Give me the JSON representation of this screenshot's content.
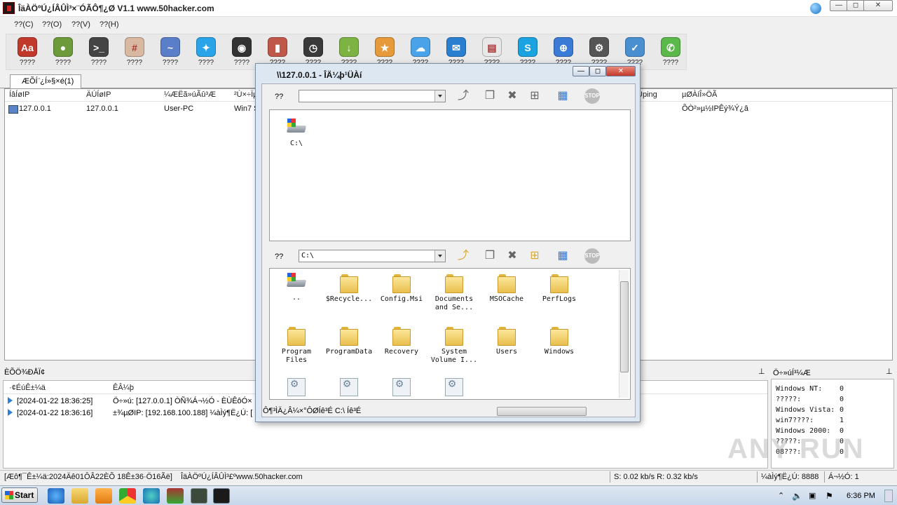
{
  "window": {
    "title": "ÎäÀÖºÚ¿ÍÂÛÌ³×¨ÓÃÔ¶¿Ø V1.1 www.50hacker.com",
    "min": "—",
    "max": "◻",
    "close": "✕"
  },
  "menu": [
    "??(C)",
    "??(O)",
    "??(V)",
    "??(H)"
  ],
  "toolbar": [
    {
      "label": "????",
      "icon": "dictionary-icon",
      "color": "#c0392b",
      "glyph": "Aa"
    },
    {
      "label": "????",
      "icon": "disk-icon",
      "color": "#6d9a3a",
      "glyph": "●"
    },
    {
      "label": "????",
      "icon": "terminal-icon",
      "color": "#444444",
      "glyph": ">_"
    },
    {
      "label": "????",
      "icon": "calculator-icon",
      "color": "#d8b8a0",
      "glyph": "#"
    },
    {
      "label": "????",
      "icon": "activity-monitor-icon",
      "color": "#5a7ec8",
      "glyph": "~"
    },
    {
      "label": "????",
      "icon": "app-store-icon",
      "color": "#2aa4e8",
      "glyph": "✦"
    },
    {
      "label": "????",
      "icon": "camera-icon",
      "color": "#333333",
      "glyph": "◉"
    },
    {
      "label": "????",
      "icon": "microphone-icon",
      "color": "#c0584a",
      "glyph": "▮"
    },
    {
      "label": "????",
      "icon": "clock-icon",
      "color": "#3a3a3a",
      "glyph": "◷"
    },
    {
      "label": "????",
      "icon": "download-icon",
      "color": "#7cb342",
      "glyph": "↓"
    },
    {
      "label": "????",
      "icon": "star-icon",
      "color": "#e69a3a",
      "glyph": "★"
    },
    {
      "label": "????",
      "icon": "cloud-icon",
      "color": "#4aa3e8",
      "glyph": "☁"
    },
    {
      "label": "????",
      "icon": "chat-icon",
      "color": "#2a7fd0",
      "glyph": "✉"
    },
    {
      "label": "????",
      "icon": "calendar-icon",
      "color": "#e8e8e8",
      "glyph": "▤"
    },
    {
      "label": "????",
      "icon": "skype-icon",
      "color": "#1aa3e0",
      "glyph": "S"
    },
    {
      "label": "????",
      "icon": "globe-icon",
      "color": "#3a7bd5",
      "glyph": "⊕"
    },
    {
      "label": "????",
      "icon": "settings-icon",
      "color": "#555555",
      "glyph": "⚙"
    },
    {
      "label": "????",
      "icon": "checklist-icon",
      "color": "#4a8fd0",
      "glyph": "✓"
    },
    {
      "label": "????",
      "icon": "phone-icon",
      "color": "#5bb84a",
      "glyph": "✆"
    }
  ],
  "tab": {
    "label": "ÆÕÍ¨¿Í»§×é(1)"
  },
  "hosts": {
    "columns": [
      "ÍâÍøIP",
      "ÄÚÍøIP",
      "¼ÆËã»úÃû³Æ",
      "²Ù×÷ÏµÍ³",
      "Uping",
      "µØÀíÎ»ÖÃ"
    ],
    "row": {
      "wan_ip": "127.0.0.1",
      "lan_ip": "127.0.0.1",
      "computer": "User-PC",
      "os": "Win7 SP",
      "location": "ÕÒ²»µ½IPÊý¾Ý¿â"
    }
  },
  "log_section": {
    "title": "ÈÕÖ¾ÐÅÏ¢",
    "columns": [
      "·¢ÉúÊ±¼ä",
      "ÊÂ¼þ"
    ],
    "rows": [
      {
        "time": "[2024-01-22 18:36:25]",
        "event": "Ö÷»ú: [127.0.0.1] ÒÑ¾­Á¬½Ó - ÈÙÊôÓ×"
      },
      {
        "time": "[2024-01-22 18:36:16]",
        "event": "±¾µØIP: [192.168.100.188] ¼àÌý¶Ë¿Ú: ["
      }
    ]
  },
  "stats": {
    "title": "Ö÷»úÍ³¼Æ",
    "rows": [
      {
        "label": "Windows NT:",
        "value": "0"
      },
      {
        "label": "?????:",
        "value": "0"
      },
      {
        "label": "Windows Vista:",
        "value": "0"
      },
      {
        "label": "win7????:",
        "value": "1"
      },
      {
        "label": "Windows 2000:",
        "value": "0"
      },
      {
        "label": "?????:",
        "value": "0"
      },
      {
        "label": "08???:",
        "value": "0"
      }
    ]
  },
  "statusbar": {
    "left": "[Æô¶¯Ê±¼ä:2024Äê01ÔÂ22ÈÕ 18Ê±36·Ö16Ãë]",
    "site": "ÎäÀÖºÚ¿ÍÂÛÌ³£ºwww.50hacker.com",
    "speed": "S: 0.02 kb/s R: 0.32 kb/s",
    "port": "¼àÌý¶Ë¿Ú: 8888",
    "online": "Á¬½Ó: 1"
  },
  "dialog": {
    "title": "\\\\127.0.0.1 - ÎÄ¼þ¹ÜÀí",
    "local_label": "??",
    "remote_label": "??",
    "local_path": "",
    "remote_path": "C:\\",
    "local_items": [
      {
        "name": "C:\\",
        "kind": "drive"
      }
    ],
    "remote_items": [
      {
        "name": "..",
        "kind": "drive"
      },
      {
        "name": "$Recycle...",
        "kind": "folder"
      },
      {
        "name": "Config.Msi",
        "kind": "folder"
      },
      {
        "name": "Documents and Se...",
        "kind": "folder"
      },
      {
        "name": "MSOCache",
        "kind": "folder"
      },
      {
        "name": "PerfLogs",
        "kind": "folder"
      },
      {
        "name": "Program Files",
        "kind": "folder"
      },
      {
        "name": "ProgramData",
        "kind": "folder"
      },
      {
        "name": "Recovery",
        "kind": "folder"
      },
      {
        "name": "System Volume I...",
        "kind": "folder"
      },
      {
        "name": "Users",
        "kind": "folder"
      },
      {
        "name": "Windows",
        "kind": "folder"
      },
      {
        "name": "",
        "kind": "file"
      },
      {
        "name": "",
        "kind": "file"
      },
      {
        "name": "",
        "kind": "file"
      },
      {
        "name": "",
        "kind": "file"
      }
    ],
    "status": "Ô¶³ÌÄ¿Â¼×°ÔØÍê³É C:\\ Íê³É"
  },
  "taskbar": {
    "start": "Start",
    "clock": "6:36 PM"
  },
  "watermark": "ANY RUN"
}
